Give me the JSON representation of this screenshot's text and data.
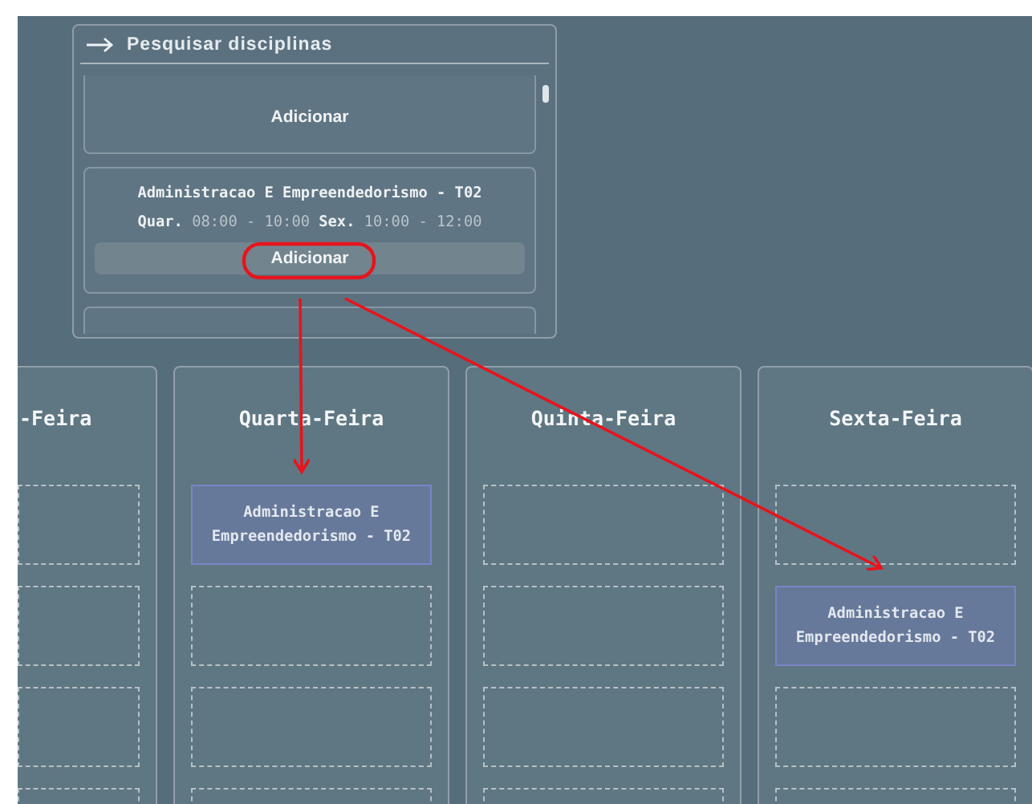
{
  "search_panel": {
    "title": "Pesquisar disciplinas",
    "cards": [
      {
        "kind": "partial-top",
        "button": "Adicionar",
        "highlighted": false
      },
      {
        "kind": "full",
        "title": "Administracao E Empreendedorismo - T02",
        "schedule": "**Quar.** 08:00 - 10:00 **Sex.** 10:00 - 12:00",
        "button": "Adicionar",
        "highlighted": true
      },
      {
        "kind": "partial-bottom"
      }
    ]
  },
  "days": [
    {
      "name": "-Feira",
      "slots": [
        {
          "kind": "empty"
        },
        {
          "kind": "empty"
        },
        {
          "kind": "empty"
        },
        {
          "kind": "empty"
        }
      ]
    },
    {
      "name": "Quarta-Feira",
      "slots": [
        {
          "kind": "class",
          "title": "Administracao E Empreendedorismo - T02"
        },
        {
          "kind": "empty"
        },
        {
          "kind": "empty"
        },
        {
          "kind": "empty"
        }
      ]
    },
    {
      "name": "Quinta-Feira",
      "slots": [
        {
          "kind": "empty"
        },
        {
          "kind": "empty"
        },
        {
          "kind": "empty"
        },
        {
          "kind": "empty"
        }
      ]
    },
    {
      "name": "Sexta-Feira",
      "slots": [
        {
          "kind": "empty"
        },
        {
          "kind": "class",
          "title": "Administracao E Empreendedorismo - T02"
        },
        {
          "kind": "empty"
        },
        {
          "kind": "empty"
        }
      ]
    }
  ]
}
